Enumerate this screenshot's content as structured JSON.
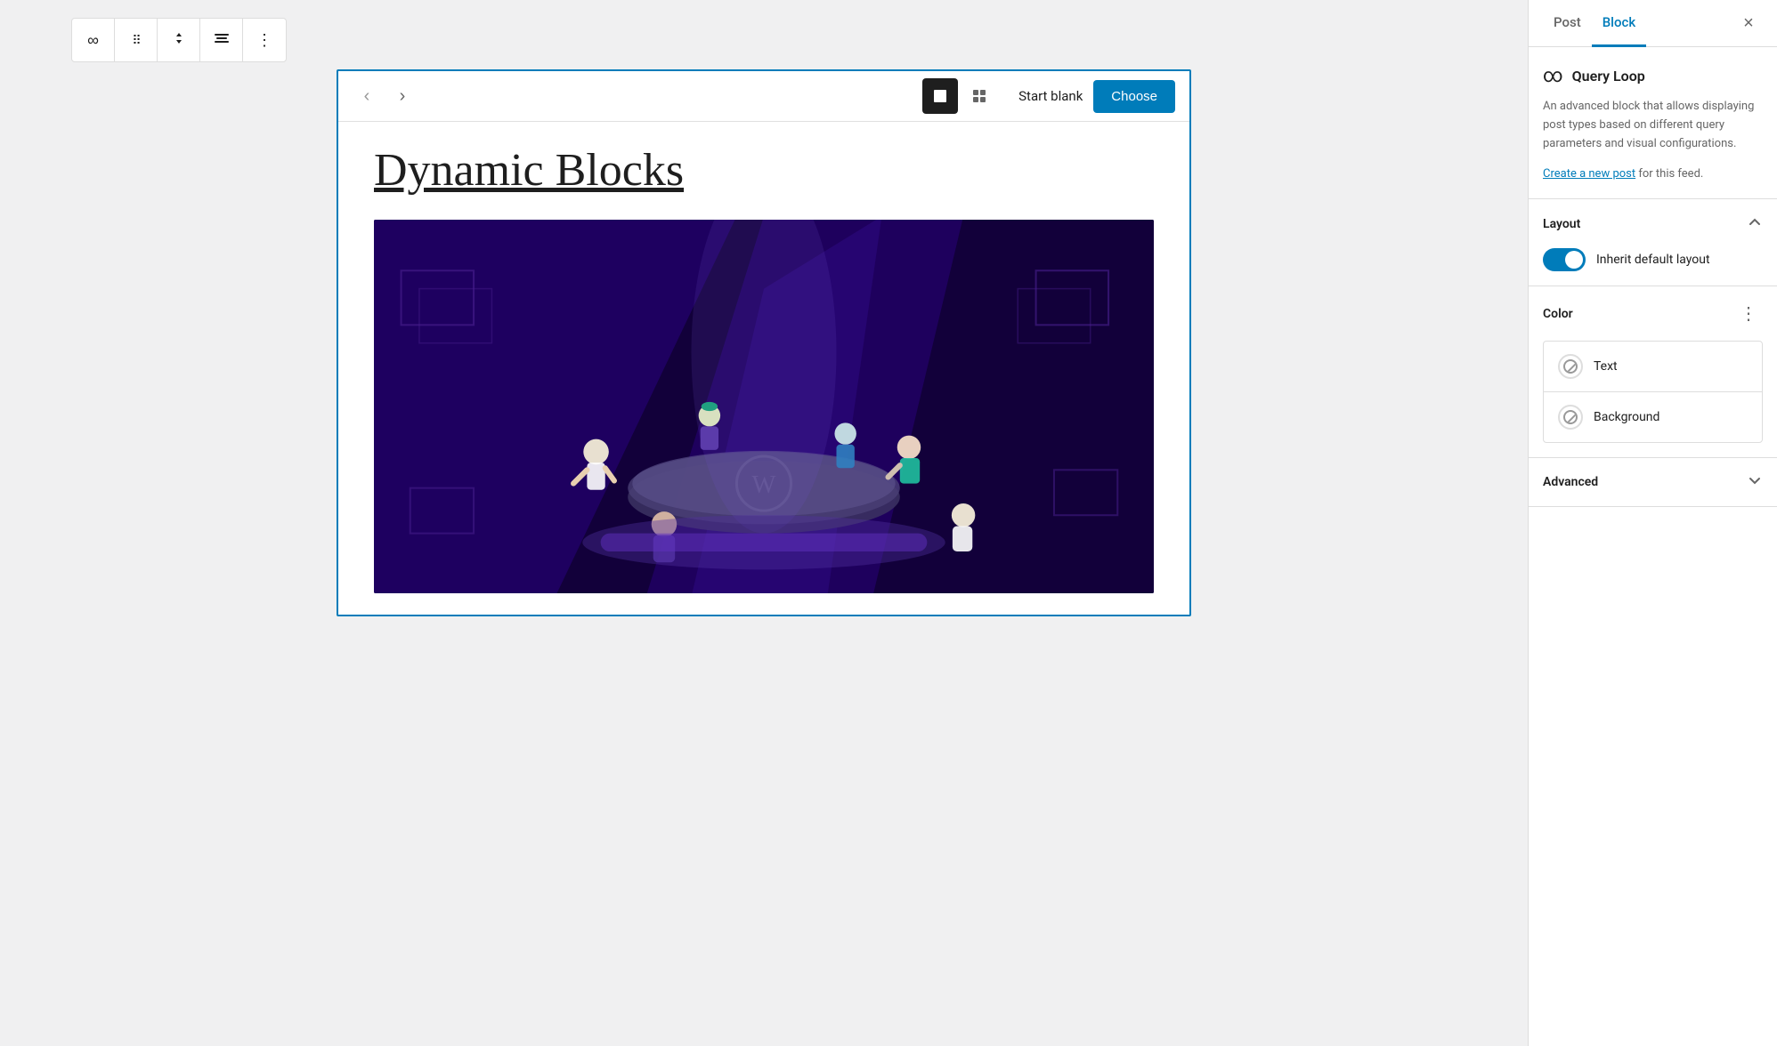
{
  "toolbar": {
    "link_icon": "∞",
    "drag_icon": "⠿",
    "move_icon": "⌃⌄",
    "align_icon": "align",
    "more_icon": "⋮"
  },
  "block_inner_toolbar": {
    "prev_label": "‹",
    "next_label": "›",
    "start_blank_label": "Start blank",
    "choose_label": "Choose"
  },
  "content": {
    "post_title": "Dynamic Blocks"
  },
  "sidebar": {
    "tab_post": "Post",
    "tab_block": "Block",
    "close_icon": "×",
    "block_info": {
      "icon": "∞",
      "name": "Query Loop",
      "description": "An advanced block that allows displaying post types based on different query parameters and visual configurations.",
      "create_link_text": "Create a new post",
      "create_link_suffix": " for this feed."
    },
    "layout": {
      "title": "Layout",
      "toggle_label": "Inherit default layout",
      "toggle_on": true
    },
    "color": {
      "title": "Color",
      "options": [
        {
          "label": "Text"
        },
        {
          "label": "Background"
        }
      ]
    },
    "advanced": {
      "title": "Advanced"
    }
  }
}
